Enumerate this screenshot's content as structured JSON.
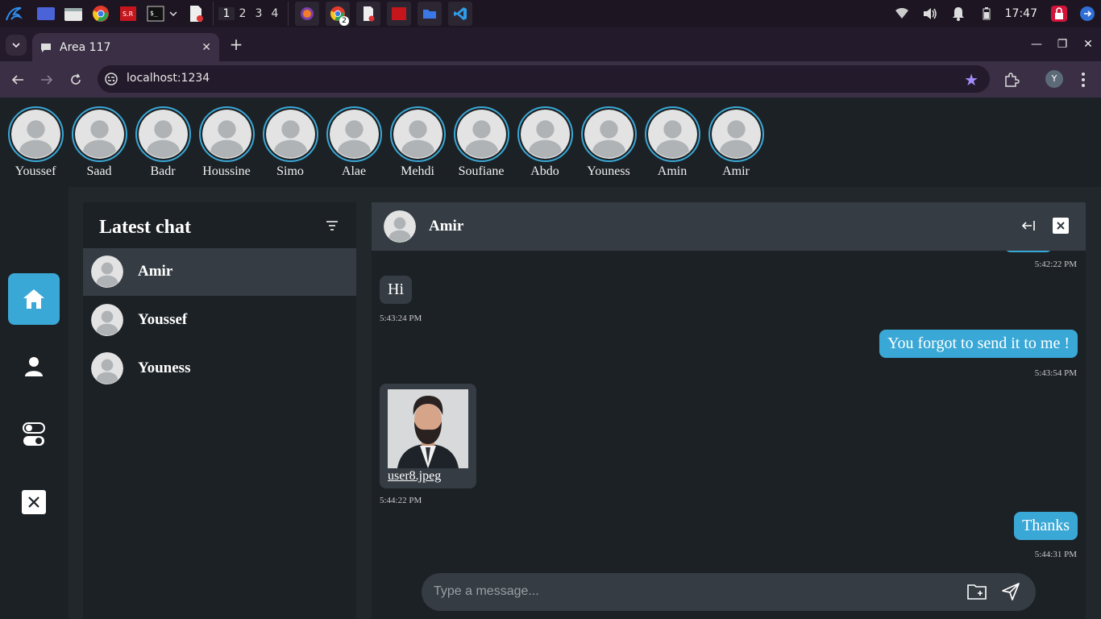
{
  "os": {
    "workspaces": [
      "1",
      "2",
      "3",
      "4"
    ],
    "clock": "17:47",
    "badge_count": "2"
  },
  "browser": {
    "tab_title": "Area 117",
    "url": "localhost:1234",
    "profile_initial": "Y"
  },
  "stories": [
    {
      "name": "Youssef"
    },
    {
      "name": "Saad"
    },
    {
      "name": "Badr"
    },
    {
      "name": "Houssine"
    },
    {
      "name": "Simo"
    },
    {
      "name": "Alae"
    },
    {
      "name": "Mehdi"
    },
    {
      "name": "Soufiane"
    },
    {
      "name": "Abdo"
    },
    {
      "name": "Youness"
    },
    {
      "name": "Amin"
    },
    {
      "name": "Amir"
    }
  ],
  "chatlist": {
    "title": "Latest chat",
    "items": [
      {
        "name": "Amir",
        "active": true
      },
      {
        "name": "Youssef",
        "active": false
      },
      {
        "name": "Youness",
        "active": false
      }
    ]
  },
  "conversation": {
    "contact": "Amir",
    "messages": [
      {
        "dir": "out",
        "text": "",
        "time": "5:42:22 PM"
      },
      {
        "dir": "in",
        "text": "Hi",
        "time": "5:43:24 PM"
      },
      {
        "dir": "out",
        "text": "You forgot to send it to me !",
        "time": "5:43:54 PM"
      },
      {
        "dir": "in",
        "type": "image",
        "file": "user8.jpeg",
        "time": "5:44:22 PM"
      },
      {
        "dir": "out",
        "text": "Thanks",
        "time": "5:44:31 PM"
      }
    ]
  },
  "composer": {
    "placeholder": "Type a message..."
  },
  "colors": {
    "accent": "#3aa8d6",
    "panel": "#1c2125",
    "header": "#353c43"
  }
}
